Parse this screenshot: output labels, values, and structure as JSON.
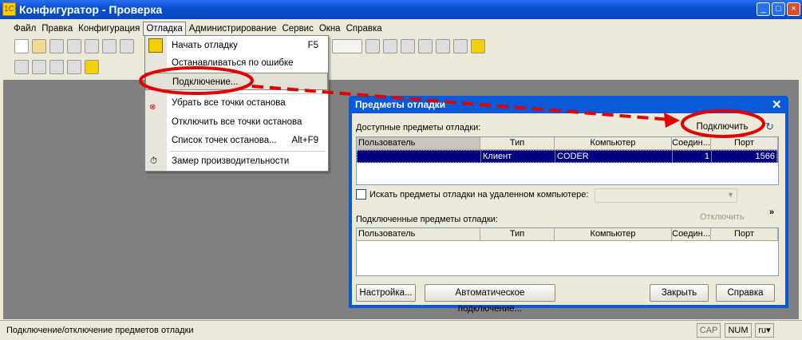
{
  "window": {
    "title": "Конфигуратор - Проверка"
  },
  "menubar": [
    "Файл",
    "Правка",
    "Конфигурация",
    "Отладка",
    "Администрирование",
    "Сервис",
    "Окна",
    "Справка"
  ],
  "debug_menu": {
    "items": [
      {
        "label": "Начать отладку",
        "shortcut": "F5"
      },
      {
        "label": "Останавливаться по ошибке",
        "shortcut": ""
      },
      {
        "label": "Подключение...",
        "shortcut": ""
      },
      {
        "label": "Убрать все точки останова",
        "shortcut": ""
      },
      {
        "label": "Отключить все точки останова",
        "shortcut": ""
      },
      {
        "label": "Список точек останова...",
        "shortcut": "Alt+F9"
      },
      {
        "label": "Замер производительности",
        "shortcut": ""
      }
    ]
  },
  "dialog": {
    "title": "Предметы отладки",
    "available_label": "Доступные предметы отладки:",
    "connect_button": "Подключить",
    "columns": [
      "Пользователь",
      "Тип",
      "Компьютер",
      "Соедин...",
      "Порт"
    ],
    "available_rows": [
      {
        "user": "",
        "type": "Клиент",
        "computer": "CODER",
        "conn": "1",
        "port": "1566"
      }
    ],
    "remote_checkbox": {
      "label": "Искать предметы отладки на удаленном компьютере:",
      "checked": false,
      "value": ""
    },
    "connected_label": "Подключенные предметы отладки:",
    "disconnect_button": "Отключить",
    "more": "»",
    "buttons": {
      "settings": "Настройка...",
      "auto": "Автоматическое подключение...",
      "close": "Закрыть",
      "help": "Справка"
    }
  },
  "statusbar": {
    "text": "Подключение/отключение предметов отладки",
    "cap": "CAP",
    "num": "NUM",
    "lang": "ru"
  },
  "annotation_color": "#e00000"
}
